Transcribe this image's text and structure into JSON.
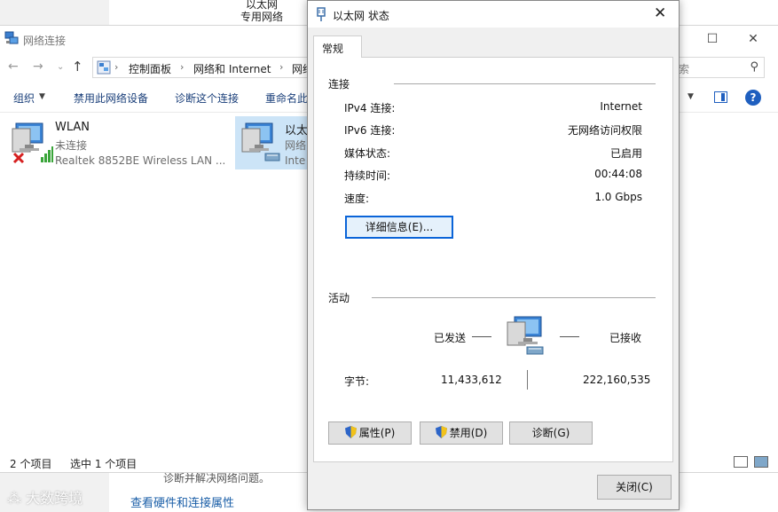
{
  "background": {
    "top_label_1": "以太网",
    "top_label_2": "专用网络",
    "bottom_cut_text": "诊断并解决网络问题。",
    "bottom_link": "查看硬件和连接属性",
    "watermark": "大数跨境"
  },
  "explorer": {
    "title": "网络连接",
    "breadcrumb": [
      "控制面板",
      "网络和 Internet",
      "网络"
    ],
    "search_placeholder": "索",
    "commands": [
      "组织",
      "禁用此网络设备",
      "诊断这个连接",
      "重命名此"
    ],
    "items": [
      {
        "name": "WLAN",
        "status": "未连接",
        "device": "Realtek 8852BE Wireless LAN ..."
      },
      {
        "name": "以太",
        "status": "网络",
        "device": "Inte"
      }
    ],
    "status": {
      "count": "2 个项目",
      "selected": "选中 1 个项目"
    }
  },
  "dialog": {
    "title": "以太网 状态",
    "tab": "常规",
    "connection": {
      "heading": "连接",
      "rows": [
        {
          "label": "IPv4 连接:",
          "value": "Internet"
        },
        {
          "label": "IPv6 连接:",
          "value": "无网络访问权限"
        },
        {
          "label": "媒体状态:",
          "value": "已启用"
        },
        {
          "label": "持续时间:",
          "value": "00:44:08"
        },
        {
          "label": "速度:",
          "value": "1.0 Gbps"
        }
      ],
      "details_button": "详细信息(E)..."
    },
    "activity": {
      "heading": "活动",
      "sent_label": "已发送",
      "received_label": "已接收",
      "bytes_label": "字节:",
      "bytes_sent": "11,433,612",
      "bytes_received": "222,160,535"
    },
    "buttons": {
      "properties": "属性(P)",
      "disable": "禁用(D)",
      "diagnose": "诊断(G)",
      "close": "关闭(C)"
    }
  }
}
